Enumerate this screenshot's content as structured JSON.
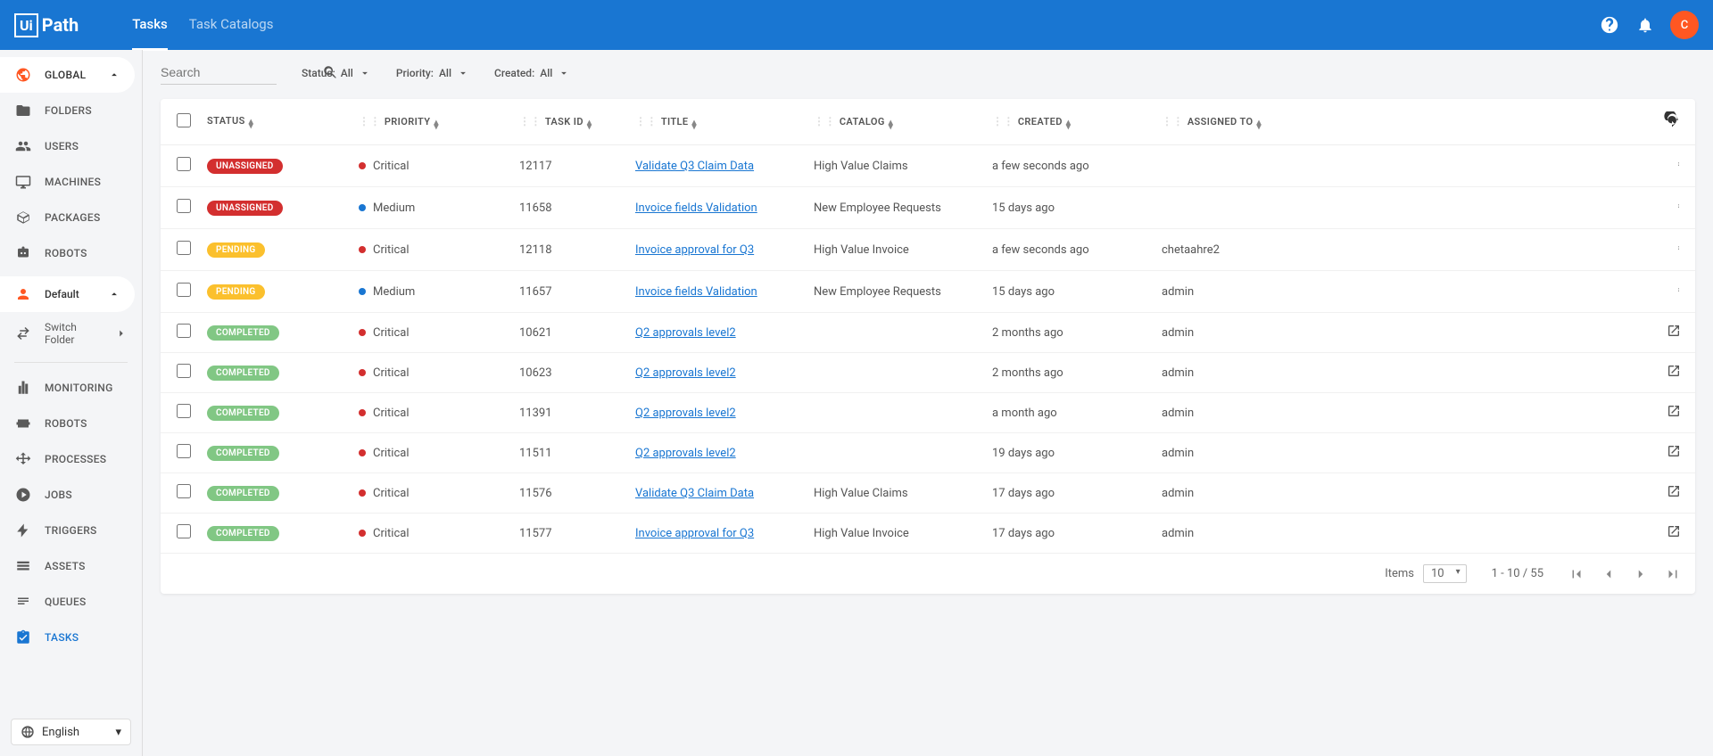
{
  "header": {
    "logo_prefix": "Ui",
    "logo_suffix": "Path",
    "tabs": [
      {
        "label": "Tasks",
        "active": true
      },
      {
        "label": "Task Catalogs",
        "active": false
      }
    ],
    "avatar_initial": "C"
  },
  "sidebar": {
    "global_label": "GLOBAL",
    "groups": {
      "folders": "FOLDERS",
      "users": "USERS",
      "machines": "MACHINES",
      "packages": "PACKAGES",
      "robots_top": "ROBOTS"
    },
    "default_label": "Default",
    "switch_folder": "Switch Folder",
    "nav": {
      "monitoring": "MONITORING",
      "robots": "ROBOTS",
      "processes": "PROCESSES",
      "jobs": "JOBS",
      "triggers": "TRIGGERS",
      "assets": "ASSETS",
      "queues": "QUEUES",
      "tasks": "TASKS"
    },
    "language": "English"
  },
  "filters": {
    "search_placeholder": "Search",
    "status_label": "Status:",
    "status_value": "All",
    "priority_label": "Priority:",
    "priority_value": "All",
    "created_label": "Created:",
    "created_value": "All"
  },
  "columns": {
    "status": "STATUS",
    "priority": "PRIORITY",
    "task_id": "TASK ID",
    "title": "TITLE",
    "catalog": "CATALOG",
    "created": "CREATED",
    "assigned_to": "ASSIGNED TO"
  },
  "rows": [
    {
      "status": "UNASSIGNED",
      "status_class": "status-unassigned",
      "priority": "Critical",
      "dot": "dot-critical",
      "task_id": "12117",
      "title": "Validate Q3 Claim Data",
      "catalog": "High Value Claims",
      "created": "a few seconds ago",
      "assigned": "",
      "action": "more"
    },
    {
      "status": "UNASSIGNED",
      "status_class": "status-unassigned",
      "priority": "Medium",
      "dot": "dot-medium",
      "task_id": "11658",
      "title": "Invoice fields Validation",
      "catalog": "New Employee Requests",
      "created": "15 days ago",
      "assigned": "",
      "action": "more"
    },
    {
      "status": "PENDING",
      "status_class": "status-pending",
      "priority": "Critical",
      "dot": "dot-critical",
      "task_id": "12118",
      "title": "Invoice approval for Q3",
      "catalog": "High Value Invoice",
      "created": "a few seconds ago",
      "assigned": "chetaahre2",
      "action": "more"
    },
    {
      "status": "PENDING",
      "status_class": "status-pending",
      "priority": "Medium",
      "dot": "dot-medium",
      "task_id": "11657",
      "title": "Invoice fields Validation",
      "catalog": "New Employee Requests",
      "created": "15 days ago",
      "assigned": "admin",
      "action": "more"
    },
    {
      "status": "COMPLETED",
      "status_class": "status-completed",
      "priority": "Critical",
      "dot": "dot-critical",
      "task_id": "10621",
      "title": "Q2 approvals level2",
      "catalog": "",
      "created": "2 months ago",
      "assigned": "admin",
      "action": "open"
    },
    {
      "status": "COMPLETED",
      "status_class": "status-completed",
      "priority": "Critical",
      "dot": "dot-critical",
      "task_id": "10623",
      "title": "Q2 approvals level2",
      "catalog": "",
      "created": "2 months ago",
      "assigned": "admin",
      "action": "open"
    },
    {
      "status": "COMPLETED",
      "status_class": "status-completed",
      "priority": "Critical",
      "dot": "dot-critical",
      "task_id": "11391",
      "title": "Q2 approvals level2",
      "catalog": "",
      "created": "a month ago",
      "assigned": "admin",
      "action": "open"
    },
    {
      "status": "COMPLETED",
      "status_class": "status-completed",
      "priority": "Critical",
      "dot": "dot-critical",
      "task_id": "11511",
      "title": "Q2 approvals level2",
      "catalog": "",
      "created": "19 days ago",
      "assigned": "admin",
      "action": "open"
    },
    {
      "status": "COMPLETED",
      "status_class": "status-completed",
      "priority": "Critical",
      "dot": "dot-critical",
      "task_id": "11576",
      "title": "Validate Q3 Claim Data",
      "catalog": "High Value Claims",
      "created": "17 days ago",
      "assigned": "admin",
      "action": "open"
    },
    {
      "status": "COMPLETED",
      "status_class": "status-completed",
      "priority": "Critical",
      "dot": "dot-critical",
      "task_id": "11577",
      "title": "Invoice approval for Q3",
      "catalog": "High Value Invoice",
      "created": "17 days ago",
      "assigned": "admin",
      "action": "open"
    }
  ],
  "pager": {
    "items_label": "Items",
    "per_page": "10",
    "range": "1 - 10 / 55"
  }
}
